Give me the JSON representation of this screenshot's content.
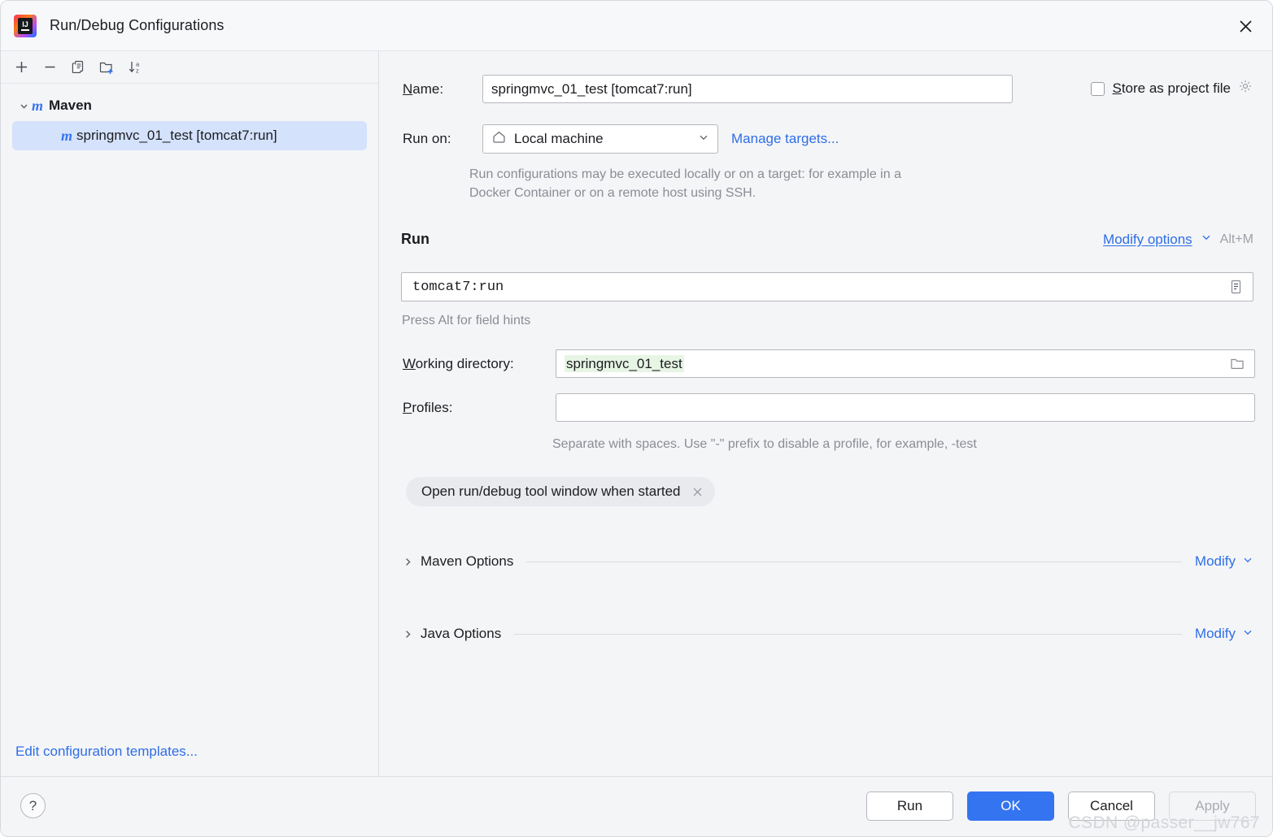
{
  "window": {
    "title": "Run/Debug Configurations",
    "app_icon": "intellij-idea-icon",
    "close_icon": "close-icon"
  },
  "toolbar": {
    "add": "+",
    "remove": "−",
    "copy": "copy-icon",
    "new_folder": "new-folder-icon",
    "sort": "sort-alphabetical-icon"
  },
  "sidebar": {
    "group": {
      "label": "Maven",
      "icon": "m"
    },
    "item": {
      "label": "springmvc_01_test [tomcat7:run]",
      "icon": "m",
      "selected": true
    },
    "edit_templates_link": "Edit configuration templates..."
  },
  "form": {
    "name_label": "Name:",
    "name_mnemonic": "N",
    "name_value": "springmvc_01_test [tomcat7:run]",
    "store_as_project_file": {
      "label_mnemonic": "S",
      "label_rest": "tore as project file",
      "checked": false,
      "gear_icon": "gear-icon"
    },
    "run_on_label": "Run on:",
    "run_on_value": "Local machine",
    "run_on_icon": "home-icon",
    "manage_targets_link": "Manage targets...",
    "run_on_description": "Run configurations may be executed locally or on a target: for example in a Docker Container or on a remote host using SSH.",
    "run_section_title": "Run",
    "modify_options_link": "Modify options",
    "modify_options_shortcut": "Alt+M",
    "command_value": "tomcat7:run",
    "command_expand_icon": "document-icon",
    "command_hint": "Press Alt for field hints",
    "working_directory_mnemonic": "W",
    "working_directory_label_rest": "orking directory:",
    "working_directory_value": "springmvc_01_test",
    "working_directory_browse_icon": "folder-icon",
    "profiles_mnemonic": "P",
    "profiles_label_rest": "rofiles:",
    "profiles_value": "",
    "profiles_hint": "Separate with spaces. Use \"-\" prefix to disable a profile, for example, -test",
    "chip_label": "Open run/debug tool window when started",
    "chip_remove_icon": "close-icon",
    "sections": [
      {
        "title": "Maven Options",
        "modify_label": "Modify",
        "expanded": false
      },
      {
        "title": "Java Options",
        "modify_label": "Modify",
        "expanded": false
      }
    ]
  },
  "footer": {
    "help": "?",
    "run_button": "Run",
    "ok_button": "OK",
    "cancel_button": "Cancel",
    "apply_button": "Apply",
    "apply_disabled": true
  },
  "watermark": "CSDN @passer__jw767",
  "colors": {
    "accent": "#3574f0",
    "link": "#2e6ee6",
    "selection": "#d4e2fc",
    "macro_highlight": "#e7f5e4",
    "panel_bg": "#f4f5f7"
  }
}
